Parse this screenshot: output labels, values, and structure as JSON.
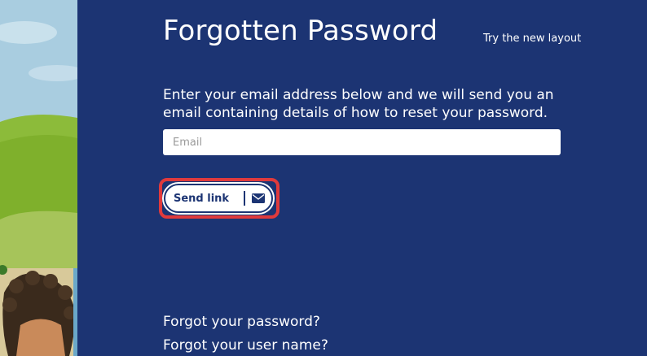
{
  "page": {
    "title": "Forgotten Password",
    "new_layout_link": "Try the new layout",
    "instructions": "Enter your email address below and we will send you an email containing details of how to reset your password."
  },
  "form": {
    "email_placeholder": "Email",
    "email_value": "",
    "send_label": "Send link",
    "send_icon": "envelope-icon"
  },
  "footer_links": {
    "forgot_password": "Forgot your password?",
    "forgot_username": "Forgot your user name?"
  },
  "colors": {
    "background": "#1c3473",
    "focus_ring": "#e03a3c",
    "text": "#ffffff"
  }
}
